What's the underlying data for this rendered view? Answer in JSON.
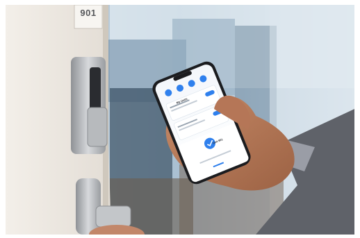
{
  "door": {
    "room_number": "901"
  },
  "phone": {
    "header_label": "My Units",
    "unlocked_unit": "Unit 901"
  }
}
